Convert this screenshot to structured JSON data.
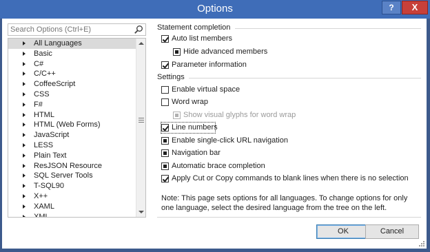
{
  "window": {
    "title": "Options",
    "help_label": "?",
    "close_label": "X"
  },
  "search": {
    "placeholder": "Search Options (Ctrl+E)"
  },
  "tree": {
    "items": [
      {
        "label": "All Languages",
        "selected": true
      },
      {
        "label": "Basic"
      },
      {
        "label": "C#"
      },
      {
        "label": "C/C++"
      },
      {
        "label": "CoffeeScript"
      },
      {
        "label": "CSS"
      },
      {
        "label": "F#"
      },
      {
        "label": "HTML"
      },
      {
        "label": "HTML (Web Forms)"
      },
      {
        "label": "JavaScript"
      },
      {
        "label": "LESS"
      },
      {
        "label": "Plain Text"
      },
      {
        "label": "ResJSON Resource"
      },
      {
        "label": "SQL Server Tools"
      },
      {
        "label": "T-SQL90"
      },
      {
        "label": "X++"
      },
      {
        "label": "XAML"
      },
      {
        "label": "XML"
      }
    ]
  },
  "statement_completion": {
    "heading": "Statement completion",
    "options": {
      "auto_list_members": {
        "label": "Auto list members",
        "state": "checked"
      },
      "hide_advanced_members": {
        "label": "Hide advanced members",
        "state": "indeterminate"
      },
      "parameter_information": {
        "label": "Parameter information",
        "state": "checked"
      }
    }
  },
  "settings": {
    "heading": "Settings",
    "options": {
      "enable_virtual_space": {
        "label": "Enable virtual space",
        "state": "unchecked"
      },
      "word_wrap": {
        "label": "Word wrap",
        "state": "unchecked"
      },
      "show_visual_glyphs": {
        "label": "Show visual glyphs for word wrap",
        "state": "indeterminate",
        "disabled": true
      },
      "line_numbers": {
        "label": "Line numbers",
        "state": "checked"
      },
      "single_click_url": {
        "label": "Enable single-click URL navigation",
        "state": "indeterminate"
      },
      "navigation_bar": {
        "label": "Navigation bar",
        "state": "indeterminate"
      },
      "automatic_brace_completion": {
        "label": "Automatic brace completion",
        "state": "indeterminate"
      },
      "apply_cut_copy": {
        "label": "Apply Cut or Copy commands to blank lines when there is no selection",
        "state": "checked"
      }
    }
  },
  "note": "Note: This page sets options for all languages. To change options for only one language, select the desired language from the tree on the left.",
  "buttons": {
    "ok": "OK",
    "cancel": "Cancel"
  }
}
